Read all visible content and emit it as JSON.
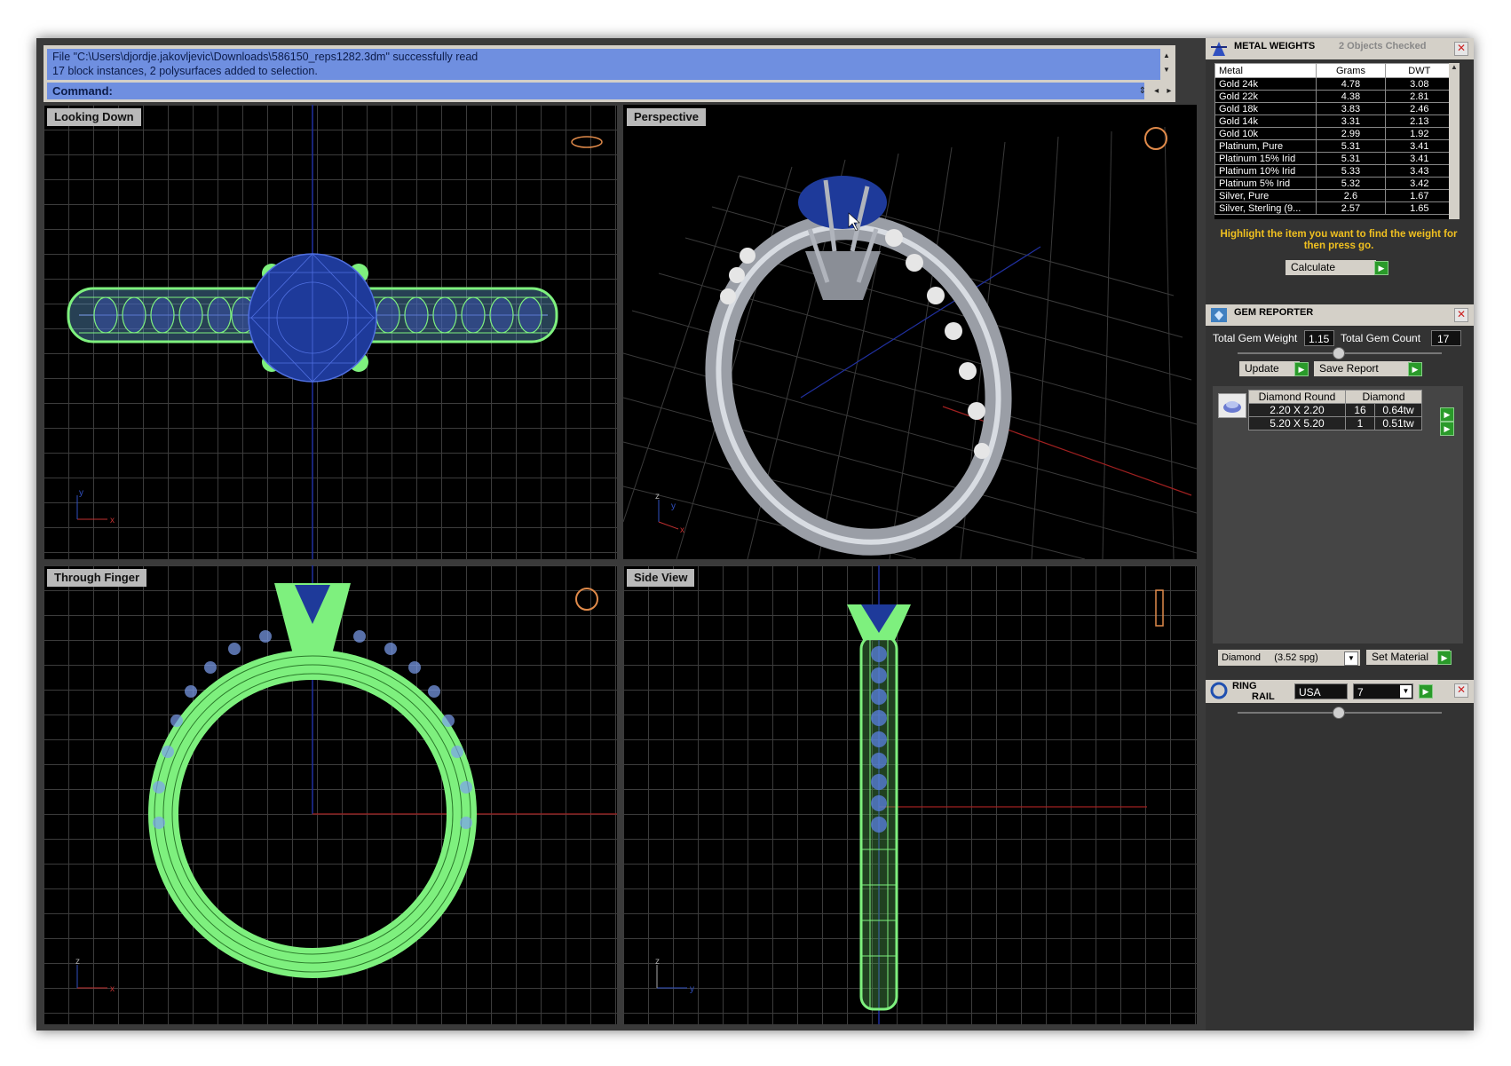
{
  "command": {
    "history": [
      "File \"C:\\Users\\djordje.jakovljevic\\Downloads\\586150_reps1282.3dm\" successfully read",
      "17 block instances, 2 polysurfaces added to selection."
    ],
    "prompt": "Command:"
  },
  "viewports": {
    "top_left": "Looking Down",
    "top_right": "Perspective",
    "bottom_left": "Through Finger",
    "bottom_right": "Side View"
  },
  "axis_labels": {
    "x": "x",
    "y": "y",
    "z": "z"
  },
  "metal_weights": {
    "title": "METAL WEIGHTS",
    "subtitle": "2 Objects Checked",
    "headers": [
      "Metal",
      "Grams",
      "DWT"
    ],
    "rows": [
      [
        "Gold 24k",
        "4.78",
        "3.08"
      ],
      [
        "Gold 22k",
        "4.38",
        "2.81"
      ],
      [
        "Gold 18k",
        "3.83",
        "2.46"
      ],
      [
        "Gold 14k",
        "3.31",
        "2.13"
      ],
      [
        "Gold 10k",
        "2.99",
        "1.92"
      ],
      [
        "Platinum, Pure",
        "5.31",
        "3.41"
      ],
      [
        "Platinum 15% Irid",
        "5.31",
        "3.41"
      ],
      [
        "Platinum 10% Irid",
        "5.33",
        "3.43"
      ],
      [
        "Platinum 5% Irid",
        "5.32",
        "3.42"
      ],
      [
        "Silver, Pure",
        "2.6",
        "1.67"
      ],
      [
        "Silver, Sterling (9...",
        "2.57",
        "1.65"
      ]
    ],
    "hint": "Highlight the item you want to find the weight for then press go.",
    "calculate_label": "Calculate"
  },
  "gem_reporter": {
    "title": "GEM REPORTER",
    "total_weight_label": "Total Gem Weight",
    "total_weight_value": "1.15",
    "total_count_label": "Total Gem Count",
    "total_count_value": "17",
    "update_label": "Update",
    "save_label": "Save Report",
    "table_headers": [
      "Diamond Round",
      "Diamond"
    ],
    "rows": [
      [
        "2.20 X 2.20",
        "16",
        "0.64tw"
      ],
      [
        "5.20 X 5.20",
        "1",
        "0.51tw"
      ]
    ],
    "material_select": "Diamond     (3.52 spg)",
    "set_material_label": "Set Material"
  },
  "ring_rail": {
    "title_line1": "RING",
    "title_line2": "RAIL",
    "country": "USA",
    "size": "7"
  },
  "colors": {
    "command_bg": "#6f8fe0",
    "wire_green": "#7ef07e",
    "gem_blue": "#1e3a9a",
    "hint_yellow": "#f0c020"
  }
}
